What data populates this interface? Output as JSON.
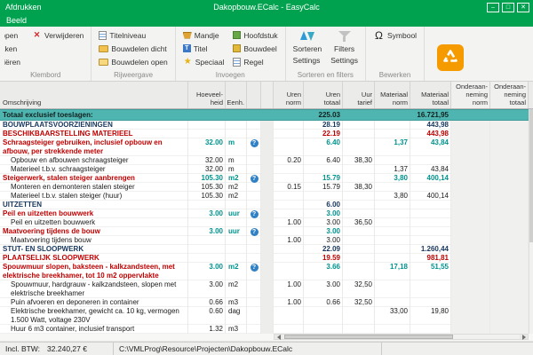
{
  "window": {
    "titlebar_left": "Afdrukken",
    "title": "Dakopbouw.ECalc  -  EasyCalc",
    "window_buttons": [
      "–",
      "□",
      "✕"
    ],
    "menu_items": [
      "Beeld"
    ]
  },
  "ribbon": {
    "groups": [
      {
        "label": "Klembord",
        "columns": [
          {
            "clip": true,
            "items": [
              {
                "label": "Knippen",
                "icon": "cut-icon"
              },
              {
                "label": "Plakken",
                "icon": "paste-icon"
              },
              {
                "label": "Kopiëren",
                "icon": "copy-icon"
              }
            ]
          },
          {
            "items": [
              {
                "label": "Verwijderen",
                "icon": "delete-icon"
              }
            ]
          }
        ]
      },
      {
        "label": "Rijweergave",
        "columns": [
          {
            "items": [
              {
                "label": "Titelniveau",
                "icon": "title-level-icon"
              },
              {
                "label": "Bouwdelen dicht",
                "icon": "folder-closed-icon"
              },
              {
                "label": "Bouwdelen open",
                "icon": "folder-open-icon"
              }
            ]
          }
        ]
      },
      {
        "label": "Invoegen",
        "columns": [
          {
            "items": [
              {
                "label": "Mandje",
                "icon": "basket-icon"
              },
              {
                "label": "Titel",
                "icon": "title-doc-icon"
              },
              {
                "label": "Speciaal",
                "icon": "special-icon"
              }
            ]
          },
          {
            "items": [
              {
                "label": "Hoofdstuk",
                "icon": "chapter-icon"
              },
              {
                "label": "Bouwdeel",
                "icon": "element-icon"
              },
              {
                "label": "Regel",
                "icon": "line-icon"
              }
            ]
          }
        ]
      },
      {
        "label": "Sorteren en filters",
        "columns": [
          {
            "items": [
              {
                "label": "Sorteren",
                "icon": "sort-icon",
                "big": true
              },
              {
                "label": "Settings",
                "icon": ""
              }
            ]
          },
          {
            "items": [
              {
                "label": "Filters",
                "icon": "filter-icon",
                "big": true
              },
              {
                "label": "Settings",
                "icon": ""
              }
            ]
          }
        ]
      },
      {
        "label": "Bewerken",
        "columns": [
          {
            "items": [
              {
                "label": "Symbool",
                "icon": "omega-icon"
              }
            ]
          }
        ]
      }
    ]
  },
  "table": {
    "headers": [
      {
        "key": "oms",
        "lines": [
          "Omschrijving"
        ]
      },
      {
        "key": "qty",
        "lines": [
          "Hoeveel-",
          "heid"
        ]
      },
      {
        "key": "unit",
        "lines": [
          "Eenh."
        ]
      },
      {
        "key": "hlp",
        "lines": []
      },
      {
        "key": "sp",
        "lines": []
      },
      {
        "key": "un",
        "lines": [
          "Uren",
          "norm"
        ]
      },
      {
        "key": "ut",
        "lines": [
          "Uren",
          "totaal"
        ]
      },
      {
        "key": "tar",
        "lines": [
          "Uur",
          "tarief"
        ]
      },
      {
        "key": "mn",
        "lines": [
          "Materiaal",
          "norm"
        ]
      },
      {
        "key": "mt",
        "lines": [
          "Materiaal",
          "totaal"
        ]
      },
      {
        "key": "on",
        "lines": [
          "Onderaan-",
          "neming",
          "norm"
        ]
      },
      {
        "key": "ot",
        "lines": [
          "Onderaan-",
          "neming",
          "totaal"
        ]
      }
    ],
    "rows": [
      {
        "type": "total",
        "oms": "Totaal exclusief toeslagen:",
        "ut": "225.03",
        "mt": "16.721,95"
      },
      {
        "type": "chapter",
        "oms": "BOUWPLAATSVOORZIENINGEN",
        "ut": "28.19",
        "mt": "443,98"
      },
      {
        "type": "sub",
        "oms": "BESCHIKBAARSTELLING MATERIEEL",
        "ut": "22.19",
        "mt": "443,98"
      },
      {
        "type": "item",
        "oms": "Schraagsteiger gebruiken, inclusief opbouw en afbouw, per strekkende meter",
        "qty": "32.00",
        "unit": "m",
        "help": true,
        "ut": "6.40",
        "mn": "1,37",
        "mt": "43,84"
      },
      {
        "type": "detail",
        "oms": "Opbouw en afbouwen schraagsteiger",
        "qty": "32.00",
        "unit": "m",
        "un": "0.20",
        "ut": "6.40",
        "tar": "38,30"
      },
      {
        "type": "detail",
        "oms": "Materieel t.b.v. schraagsteiger",
        "qty": "32.00",
        "unit": "m",
        "mn": "1,37",
        "mt": "43,84"
      },
      {
        "type": "item",
        "oms": "Steigerwerk, stalen steiger aanbrengen",
        "qty": "105.30",
        "unit": "m2",
        "help": true,
        "ut": "15.79",
        "mn": "3,80",
        "mt": "400,14"
      },
      {
        "type": "detail",
        "oms": "Monteren en demonteren stalen steiger",
        "qty": "105.30",
        "unit": "m2",
        "un": "0.15",
        "ut": "15.79",
        "tar": "38,30"
      },
      {
        "type": "detail",
        "oms": "Materieel t.b.v. stalen steiger (huur)",
        "qty": "105.30",
        "unit": "m2",
        "mn": "3,80",
        "mt": "400,14"
      },
      {
        "type": "chapter",
        "oms": "UITZETTEN",
        "ut": "6.00"
      },
      {
        "type": "item",
        "oms": "Peil en uitzetten bouwwerk",
        "qty": "3.00",
        "unit": "uur",
        "help": true,
        "ut": "3.00"
      },
      {
        "type": "detail",
        "oms": "Peil en uitzetten bouwwerk",
        "un": "1.00",
        "ut": "3.00",
        "tar": "36,50"
      },
      {
        "type": "item",
        "oms": "Maatvoering tijdens de bouw",
        "qty": "3.00",
        "unit": "uur",
        "help": true,
        "ut": "3.00"
      },
      {
        "type": "detail",
        "oms": "Maatvoering tijdens bouw",
        "un": "1.00",
        "ut": "3.00"
      },
      {
        "type": "chapter",
        "oms": "STUT- EN SLOOPWERK",
        "ut": "22.09",
        "mt": "1.260,44"
      },
      {
        "type": "sub",
        "oms": "PLAATSELIJK SLOOPWERK",
        "ut": "19.59",
        "mt": "981,81"
      },
      {
        "type": "item",
        "oms": "Spouwmuur slopen, baksteen - kalkzandsteen, met elektrische breekhamer, tot 10 m2 oppervlakte",
        "qty": "3.00",
        "unit": "m2",
        "help": true,
        "ut": "3.66",
        "mn": "17,18",
        "mt": "51,55"
      },
      {
        "type": "detail",
        "oms": "Spouwmuur, hardgrauw - kalkzandsteen, slopen met elektrische breekhamer",
        "qty": "3.00",
        "unit": "m2",
        "un": "1.00",
        "ut": "3.00",
        "tar": "32,50"
      },
      {
        "type": "detail",
        "oms": "Puin afvoeren en deponeren in container",
        "qty": "0.66",
        "unit": "m3",
        "un": "1.00",
        "ut": "0.66",
        "tar": "32,50"
      },
      {
        "type": "detail",
        "oms": "Elektrische breekhamer, gewicht ca. 10 kg, vermogen 1.500 Watt, voltage 230V",
        "qty": "0.60",
        "unit": "dag",
        "mn": "33,00",
        "mt": "19,80"
      },
      {
        "type": "detail",
        "oms": "Huur 6 m3 container, inclusief transport",
        "qty": "1.32",
        "unit": "m3"
      }
    ]
  },
  "statusbar": {
    "vat_label": "Incl. BTW:",
    "vat_value": "32.240,27 €",
    "file_path": "C:\\VMLProg\\Resource\\Projecten\\Dakopbouw.ECalc"
  },
  "colors": {
    "brand_green": "#00A24F",
    "accent_teal": "#4FB5B0",
    "chapter_navy": "#17365D",
    "item_red": "#C00000",
    "item_teal": "#00938E",
    "logo_orange": "#F59B00"
  }
}
